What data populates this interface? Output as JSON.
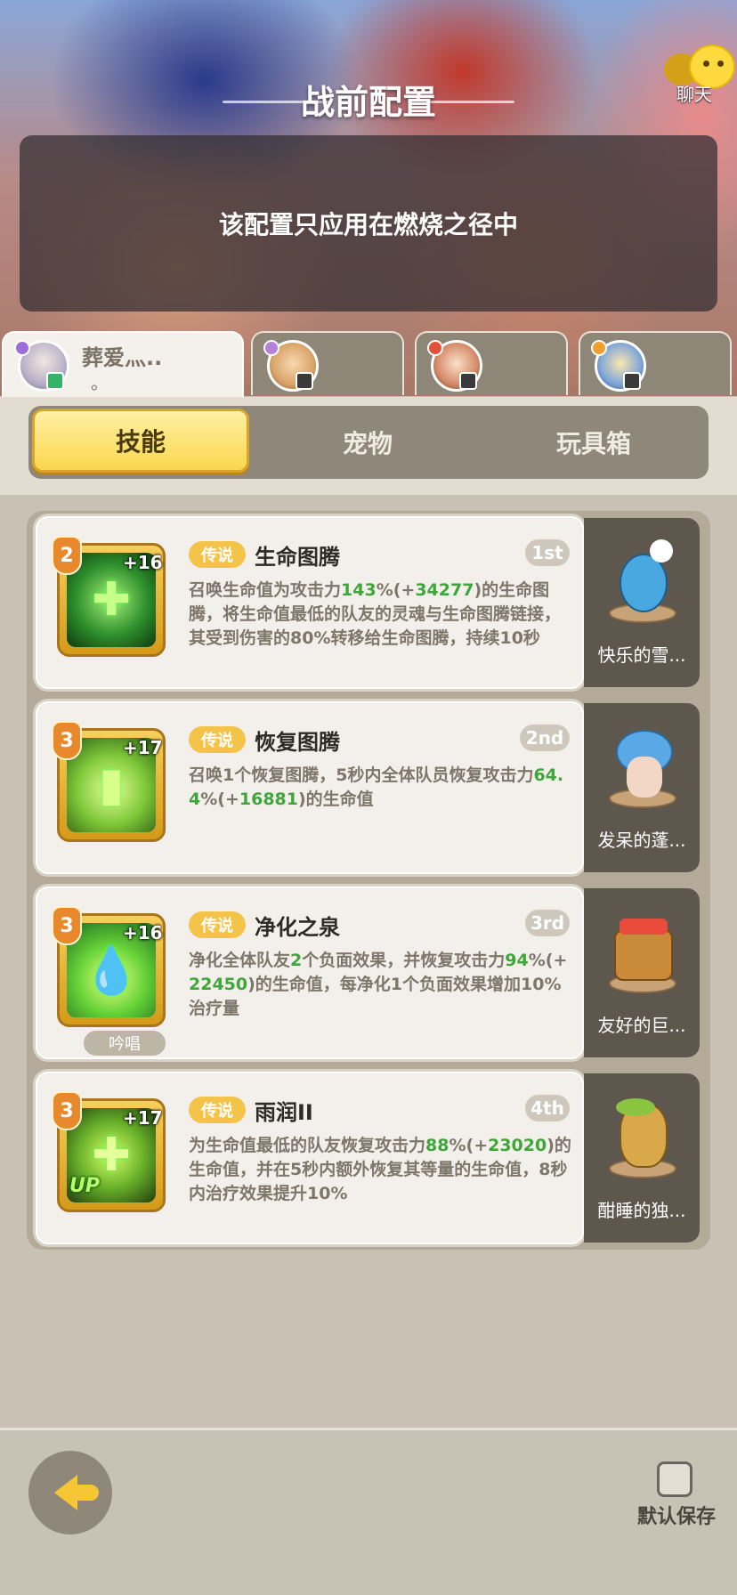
{
  "header": {
    "title": "战前配置",
    "chat_label": "聊天",
    "notice": "该配置只应用在燃烧之径中"
  },
  "characters": [
    {
      "name": "葬爱灬..",
      "name_line2": "。",
      "active": true,
      "element_color": "#9b6fd6"
    },
    {
      "name": "",
      "active": false,
      "element_color": "#b483d8"
    },
    {
      "name": "",
      "active": false,
      "element_color": "#e0533a"
    },
    {
      "name": "",
      "active": false,
      "element_color": "#f0a030"
    }
  ],
  "tabs": [
    {
      "label": "技能",
      "active": true
    },
    {
      "label": "宠物",
      "active": false
    },
    {
      "label": "玩具箱",
      "active": false
    }
  ],
  "skills": [
    {
      "level": "2",
      "plus": "+16",
      "rarity": "传说",
      "name": "生命图腾",
      "order": "1st",
      "desc_parts": [
        "召唤生命值为攻击力",
        "143",
        "%(+",
        "34277",
        ")的生命图腾，将生命值最低的队友的灵魂与生命图腾链接，其受到伤害的80%转移给生命图腾，持续10秒"
      ],
      "icon": "totem-icon",
      "pet_name": "快乐的雪..."
    },
    {
      "level": "3",
      "plus": "+17",
      "rarity": "传说",
      "name": "恢复图腾",
      "order": "2nd",
      "desc_parts": [
        "召唤1个恢复图腾，5秒内全体队员恢复攻击力",
        "64.4",
        "%(+",
        "16881",
        ")的生命值"
      ],
      "icon": "recovery-totem-icon",
      "pet_name": "发呆的蓬..."
    },
    {
      "level": "3",
      "plus": "+16",
      "rarity": "传说",
      "name": "净化之泉",
      "order": "3rd",
      "desc_parts": [
        "净化全体队友",
        "2",
        "个负面效果，并恢复攻击力",
        "94",
        "%(+",
        "22450",
        ")的生命值，每净化1个负面效果增加10%治疗量"
      ],
      "chant": "吟唱",
      "icon": "spring-drop-icon",
      "pet_name": "友好的巨..."
    },
    {
      "level": "3",
      "plus": "+17",
      "rarity": "传说",
      "name": "雨润II",
      "order": "4th",
      "desc_parts": [
        "为生命值最低的队友恢复攻击力",
        "88",
        "%(+",
        "23020",
        ")的生命值，并在5秒内额外恢复其等量的生命值，8秒内治疗效果提升10%"
      ],
      "up": "UP",
      "icon": "rain-heal-icon",
      "pet_name": "酣睡的独..."
    }
  ],
  "footer": {
    "save_default_label": "默认保存"
  },
  "colors": {
    "accent_yellow": "#fad74e",
    "highlight_green": "#3fa63a",
    "level_orange": "#e8892b"
  }
}
